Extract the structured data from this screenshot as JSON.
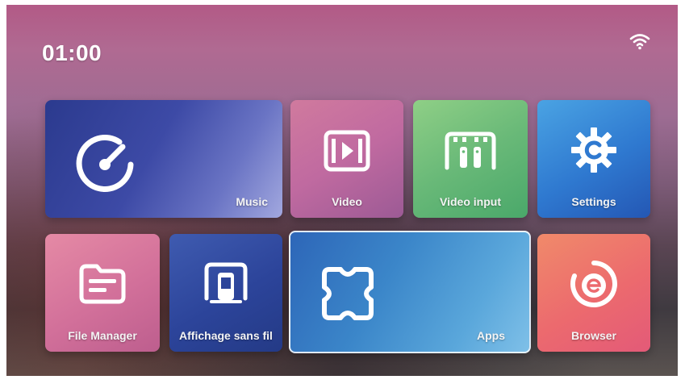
{
  "status_bar": {
    "time": "01:00",
    "wifi_icon": "wifi-icon"
  },
  "tiles": {
    "music": {
      "label": "Music",
      "icon": "music-dial-icon"
    },
    "video": {
      "label": "Video",
      "icon": "video-play-icon"
    },
    "video_input": {
      "label": "Video input",
      "icon": "video-input-icon"
    },
    "settings": {
      "label": "Settings",
      "icon": "gear-icon"
    },
    "file_manager": {
      "label": "File Manager",
      "icon": "folder-icon"
    },
    "screen_cast": {
      "label": "Affichage sans fil",
      "icon": "screen-cast-icon"
    },
    "apps": {
      "label": "Apps",
      "icon": "apps-grid-icon"
    },
    "browser": {
      "label": "Browser",
      "icon": "browser-e-icon"
    }
  },
  "colors": {
    "tile_focus_border": "#ffffff",
    "text": "#ffffff"
  }
}
